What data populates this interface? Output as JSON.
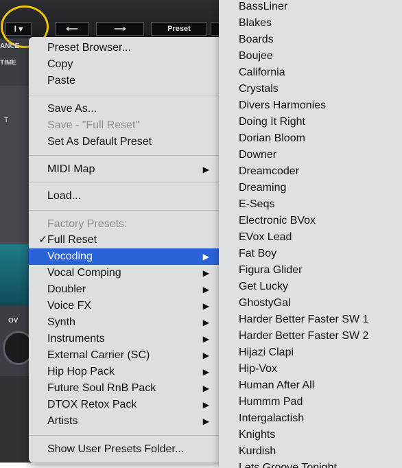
{
  "plugin": {
    "toolbar": {
      "dropdown_label": "I ▾",
      "back_arrow": "⟵",
      "forward_arrow": "⟶",
      "preset_label": "Preset"
    },
    "side_labels": [
      "ANCE",
      "TIME",
      "T",
      "OV"
    ]
  },
  "main_menu": {
    "items": [
      {
        "label": "Preset Browser...",
        "state": "normal"
      },
      {
        "label": "Copy",
        "state": "normal"
      },
      {
        "label": "Paste",
        "state": "normal"
      },
      {
        "label": "Save As...",
        "state": "normal"
      },
      {
        "label": "Save - \"Full Reset\"",
        "state": "disabled"
      },
      {
        "label": "Set As Default Preset",
        "state": "normal"
      },
      {
        "label": "MIDI Map",
        "state": "normal",
        "submenu": true
      },
      {
        "label": "Load...",
        "state": "normal"
      },
      {
        "label": "Factory Presets:",
        "state": "disabled"
      },
      {
        "label": "Full Reset",
        "state": "checked",
        "check": "✓"
      },
      {
        "label": "Vocoding",
        "state": "selected",
        "submenu": true
      },
      {
        "label": "Vocal Comping",
        "state": "normal",
        "submenu": true
      },
      {
        "label": "Doubler",
        "state": "normal",
        "submenu": true
      },
      {
        "label": "Voice FX",
        "state": "normal",
        "submenu": true
      },
      {
        "label": "Synth",
        "state": "normal",
        "submenu": true
      },
      {
        "label": "Instruments",
        "state": "normal",
        "submenu": true
      },
      {
        "label": "External Carrier (SC)",
        "state": "normal",
        "submenu": true
      },
      {
        "label": "Hip Hop Pack",
        "state": "normal",
        "submenu": true
      },
      {
        "label": "Future Soul RnB Pack",
        "state": "normal",
        "submenu": true
      },
      {
        "label": "DTOX Retox Pack",
        "state": "normal",
        "submenu": true
      },
      {
        "label": "Artists",
        "state": "normal",
        "submenu": true
      },
      {
        "label": "Show User Presets Folder...",
        "state": "normal"
      }
    ],
    "submenu_arrow": "▶"
  },
  "sub_menu": {
    "items": [
      "BassLiner",
      "Blakes",
      "Boards",
      "Boujee",
      "California",
      "Crystals",
      "Divers Harmonies",
      "Doing It Right",
      "Dorian Bloom",
      "Downer",
      "Dreamcoder",
      "Dreaming",
      "E-Seqs",
      "Electronic BVox",
      "EVox Lead",
      "Fat Boy",
      "Figura Glider",
      "Get Lucky",
      "GhostyGal",
      "Harder Better Faster SW 1",
      "Harder Better Faster SW 2",
      "Hijazi Clapi",
      "Hip-Vox",
      "Human After All",
      "Hummm Pad",
      "Intergalactish",
      "Knights",
      "Kurdish",
      "Lets Groove Tonight"
    ]
  }
}
